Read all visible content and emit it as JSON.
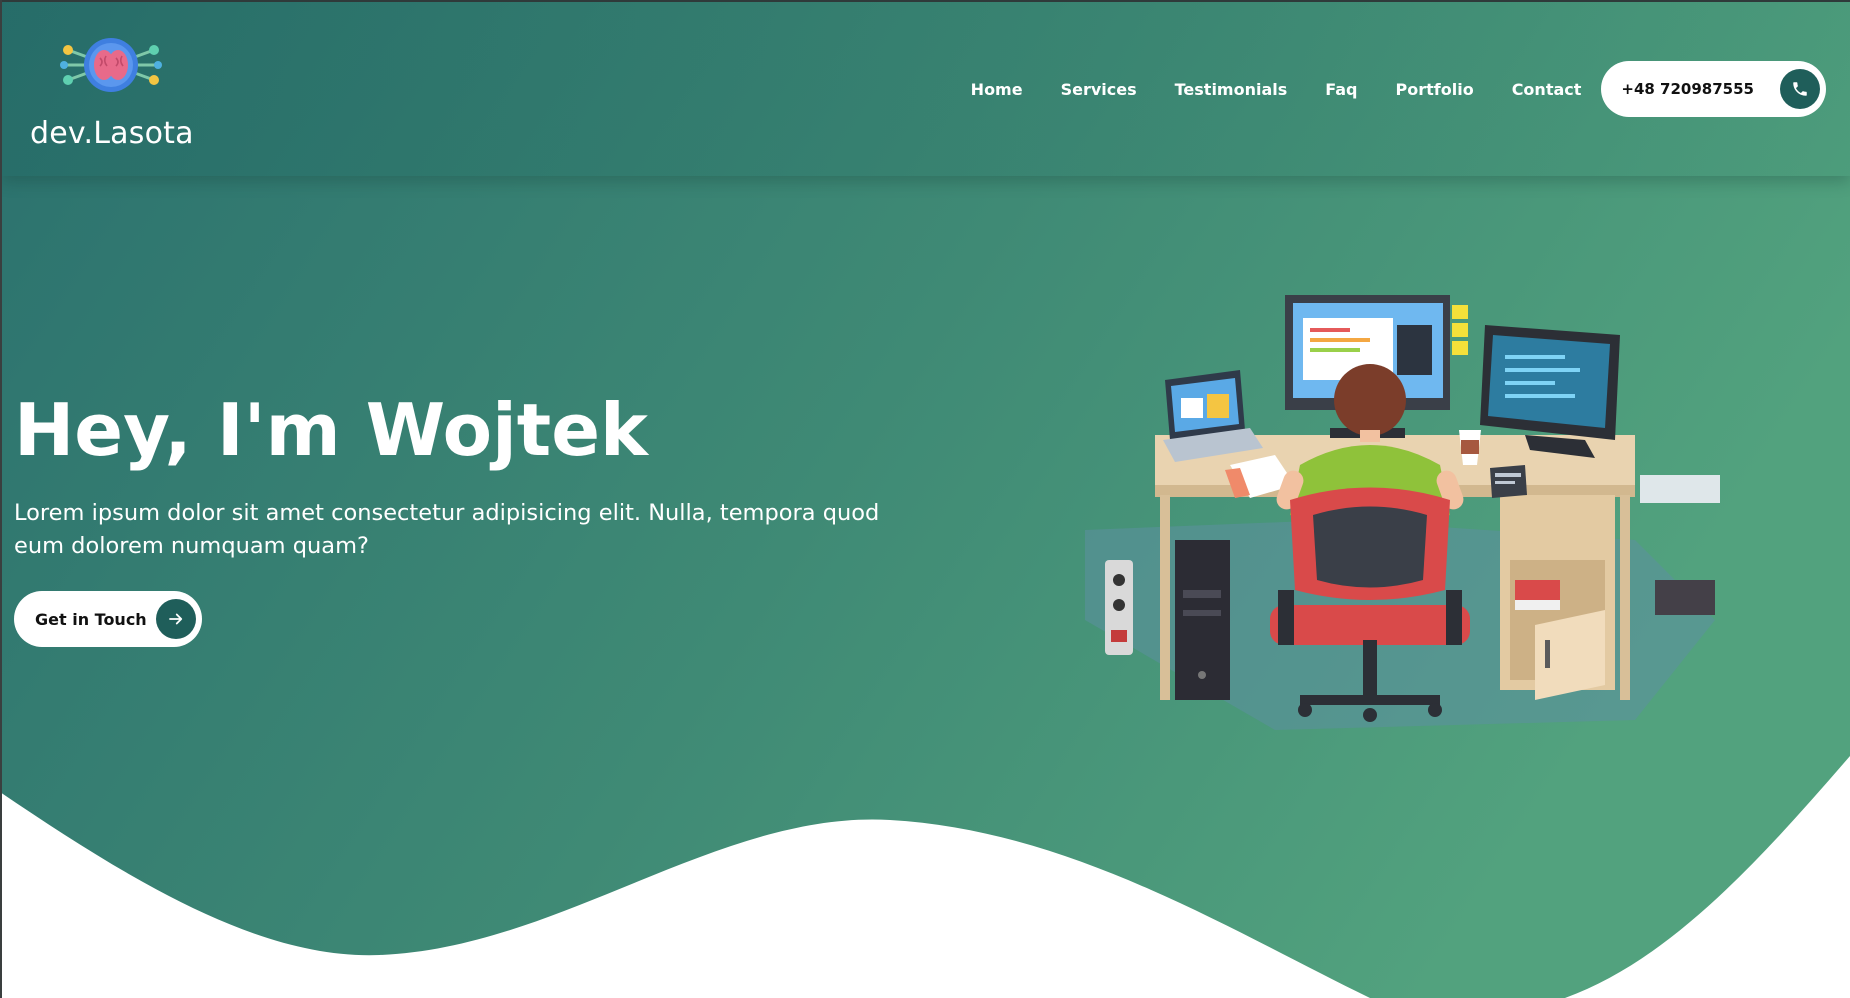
{
  "brand": {
    "name": "dev.Lasota",
    "logo_icon": "brain-circuit-icon"
  },
  "nav": {
    "items": [
      {
        "label": "Home"
      },
      {
        "label": "Services"
      },
      {
        "label": "Testimonials"
      },
      {
        "label": "Faq"
      },
      {
        "label": "Portfolio"
      },
      {
        "label": "Contact"
      }
    ],
    "phone": {
      "number": "+48 720987555",
      "icon": "phone-icon"
    }
  },
  "hero": {
    "title": "Hey, I'm Wojtek",
    "subtitle": "Lorem ipsum dolor sit amet consectetur adipisicing elit. Nulla, tempora quod eum dolorem numquam quam?",
    "cta_label": "Get in Touch",
    "cta_icon": "arrow-right-icon",
    "illustration": "developer-workstation-illustration"
  },
  "colors": {
    "gradient_start": "#2b7270",
    "gradient_end": "#4e9e7c",
    "accent_dark": "#1f5e5a",
    "wave": "#ffffff",
    "text_light": "#ffffff"
  }
}
